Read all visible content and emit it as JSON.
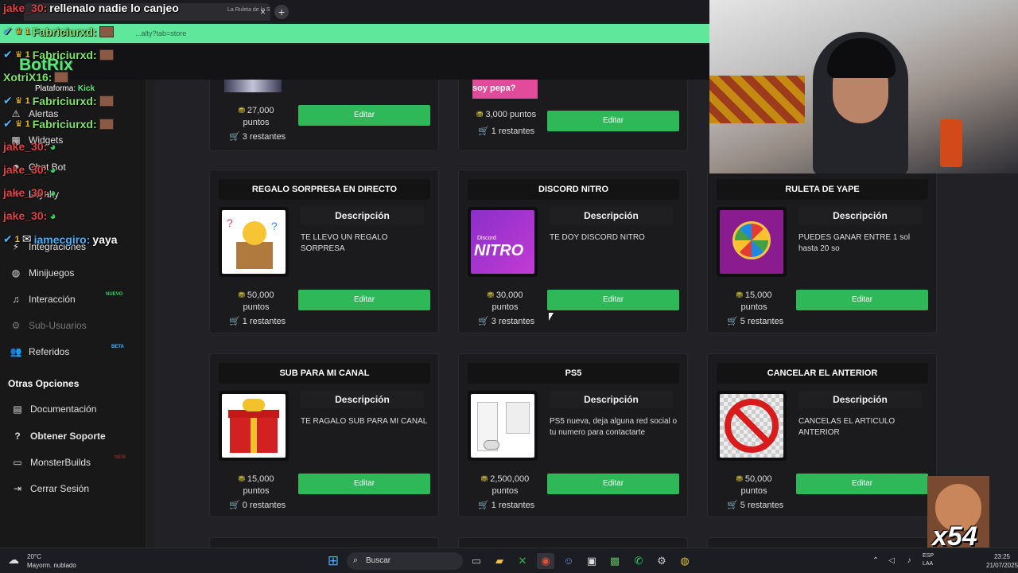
{
  "browser": {
    "tab_title": "La Ruleta de la S",
    "url": "...alty?tab=store"
  },
  "sidebar": {
    "items": [
      {
        "label": "Alertas",
        "icon": "warning-icon"
      },
      {
        "label": "Widgets",
        "icon": "widget-icon"
      },
      {
        "label": "Chat Bot",
        "icon": "bot-icon"
      },
      {
        "label": "Loyalty",
        "icon": "star-icon"
      },
      {
        "label": "Integraciones",
        "icon": "plug-icon"
      },
      {
        "label": "Minijuegos",
        "icon": "gamepad-icon"
      },
      {
        "label": "Interacción",
        "icon": "music-icon",
        "badge": "NUEVO"
      },
      {
        "label": "Sub-Usuarios",
        "icon": "users-icon"
      },
      {
        "label": "Referidos",
        "icon": "people-icon",
        "badge": "BETA"
      }
    ],
    "section_title": "Otras Opciones",
    "other": [
      {
        "label": "Documentación",
        "icon": "book-icon"
      },
      {
        "label": "Obtener Soporte",
        "icon": "help-icon"
      },
      {
        "label": "MonsterBuilds",
        "icon": "monitor-icon",
        "badge": "NEW"
      },
      {
        "label": "Cerrar Sesión",
        "icon": "logout-icon"
      }
    ]
  },
  "labels": {
    "description": "Descripción",
    "edit": "Editar",
    "points_unit": "puntos",
    "remaining_suffix": "restantes"
  },
  "top_cards": [
    {
      "points": "27,000",
      "points_unit": "puntos",
      "remaining": "3 restantes"
    },
    {
      "points": "3,000 puntos",
      "remaining": "1 restantes",
      "image_text": "soy pepa?"
    }
  ],
  "rewards": [
    {
      "title": "REGALO SORPRESA EN DIRECTO",
      "description": "TE LLEVO UN REGALO SORPRESA",
      "points": "50,000",
      "remaining": "1 restantes",
      "image": "surprise-box"
    },
    {
      "title": "DISCORD NITRO",
      "description": "TE DOY DISCORD NITRO",
      "points": "30,000",
      "remaining": "3 restantes",
      "image": "nitro",
      "image_text": "NITRO",
      "image_small": "Discord"
    },
    {
      "title": "RULETA DE YAPE",
      "description": "PUEDES GANAR ENTRE 1 sol hasta 20 so",
      "points": "15,000",
      "remaining": "5 restantes",
      "image": "wheel"
    },
    {
      "title": "SUB PARA MI CANAL",
      "description": "TE RAGALO SUB PARA MI CANAL",
      "points": "15,000",
      "remaining": "0 restantes",
      "image": "gift"
    },
    {
      "title": "PS5",
      "description": "PS5 nueva, deja alguna red social o tu numero para contactarte",
      "points": "2,500,000",
      "remaining": "1 restantes",
      "image": "ps5"
    },
    {
      "title": "CANCELAR EL ANTERIOR",
      "description": "CANCELAS EL ARTICULO ANTERIOR",
      "points": "50,000",
      "remaining": "5 restantes",
      "image": "no-sign"
    }
  ],
  "chat": [
    {
      "user": "jake_30:",
      "msg": "rellenalo nadie lo canjeo",
      "color": "#e04343"
    },
    {
      "user": "Fabriciurxd:",
      "msg": "",
      "color": "#7fe36a"
    },
    {
      "user": "Fabriciurxd:",
      "msg": "",
      "color": "#7fe36a"
    },
    {
      "user": "XotriX16:",
      "msg": "",
      "color": "#7fe36a"
    },
    {
      "user": "Fabriciurxd:",
      "msg": "",
      "color": "#7fe36a"
    },
    {
      "user": "Fabriciurxd:",
      "msg": "",
      "color": "#7fe36a"
    },
    {
      "user": "jake_30:",
      "msg": "",
      "color": "#e04343"
    },
    {
      "user": "jake_30:",
      "msg": "",
      "color": "#e04343"
    },
    {
      "user": "jake_30:",
      "msg": "",
      "color": "#e04343"
    },
    {
      "user": "jake_30:",
      "msg": "",
      "color": "#e04343"
    },
    {
      "user": "iamecgiro:",
      "msg": "yaya",
      "color": "#4ab3ff"
    }
  ],
  "overlay": {
    "botrix": "BotRix",
    "platform_label": "Plataforma:",
    "platform": "Kick",
    "multiplier": "x54",
    "badge_num": "1"
  },
  "taskbar": {
    "weather_temp": "20°C",
    "weather_desc": "Mayorm. nublado",
    "search": "Buscar",
    "lang1": "ESP",
    "lang2": "LAA",
    "time": "23:25",
    "date": "21/07/2025"
  },
  "colors": {
    "accent": "#2fb858",
    "background": "#222226",
    "card": "#1b1b1d"
  }
}
